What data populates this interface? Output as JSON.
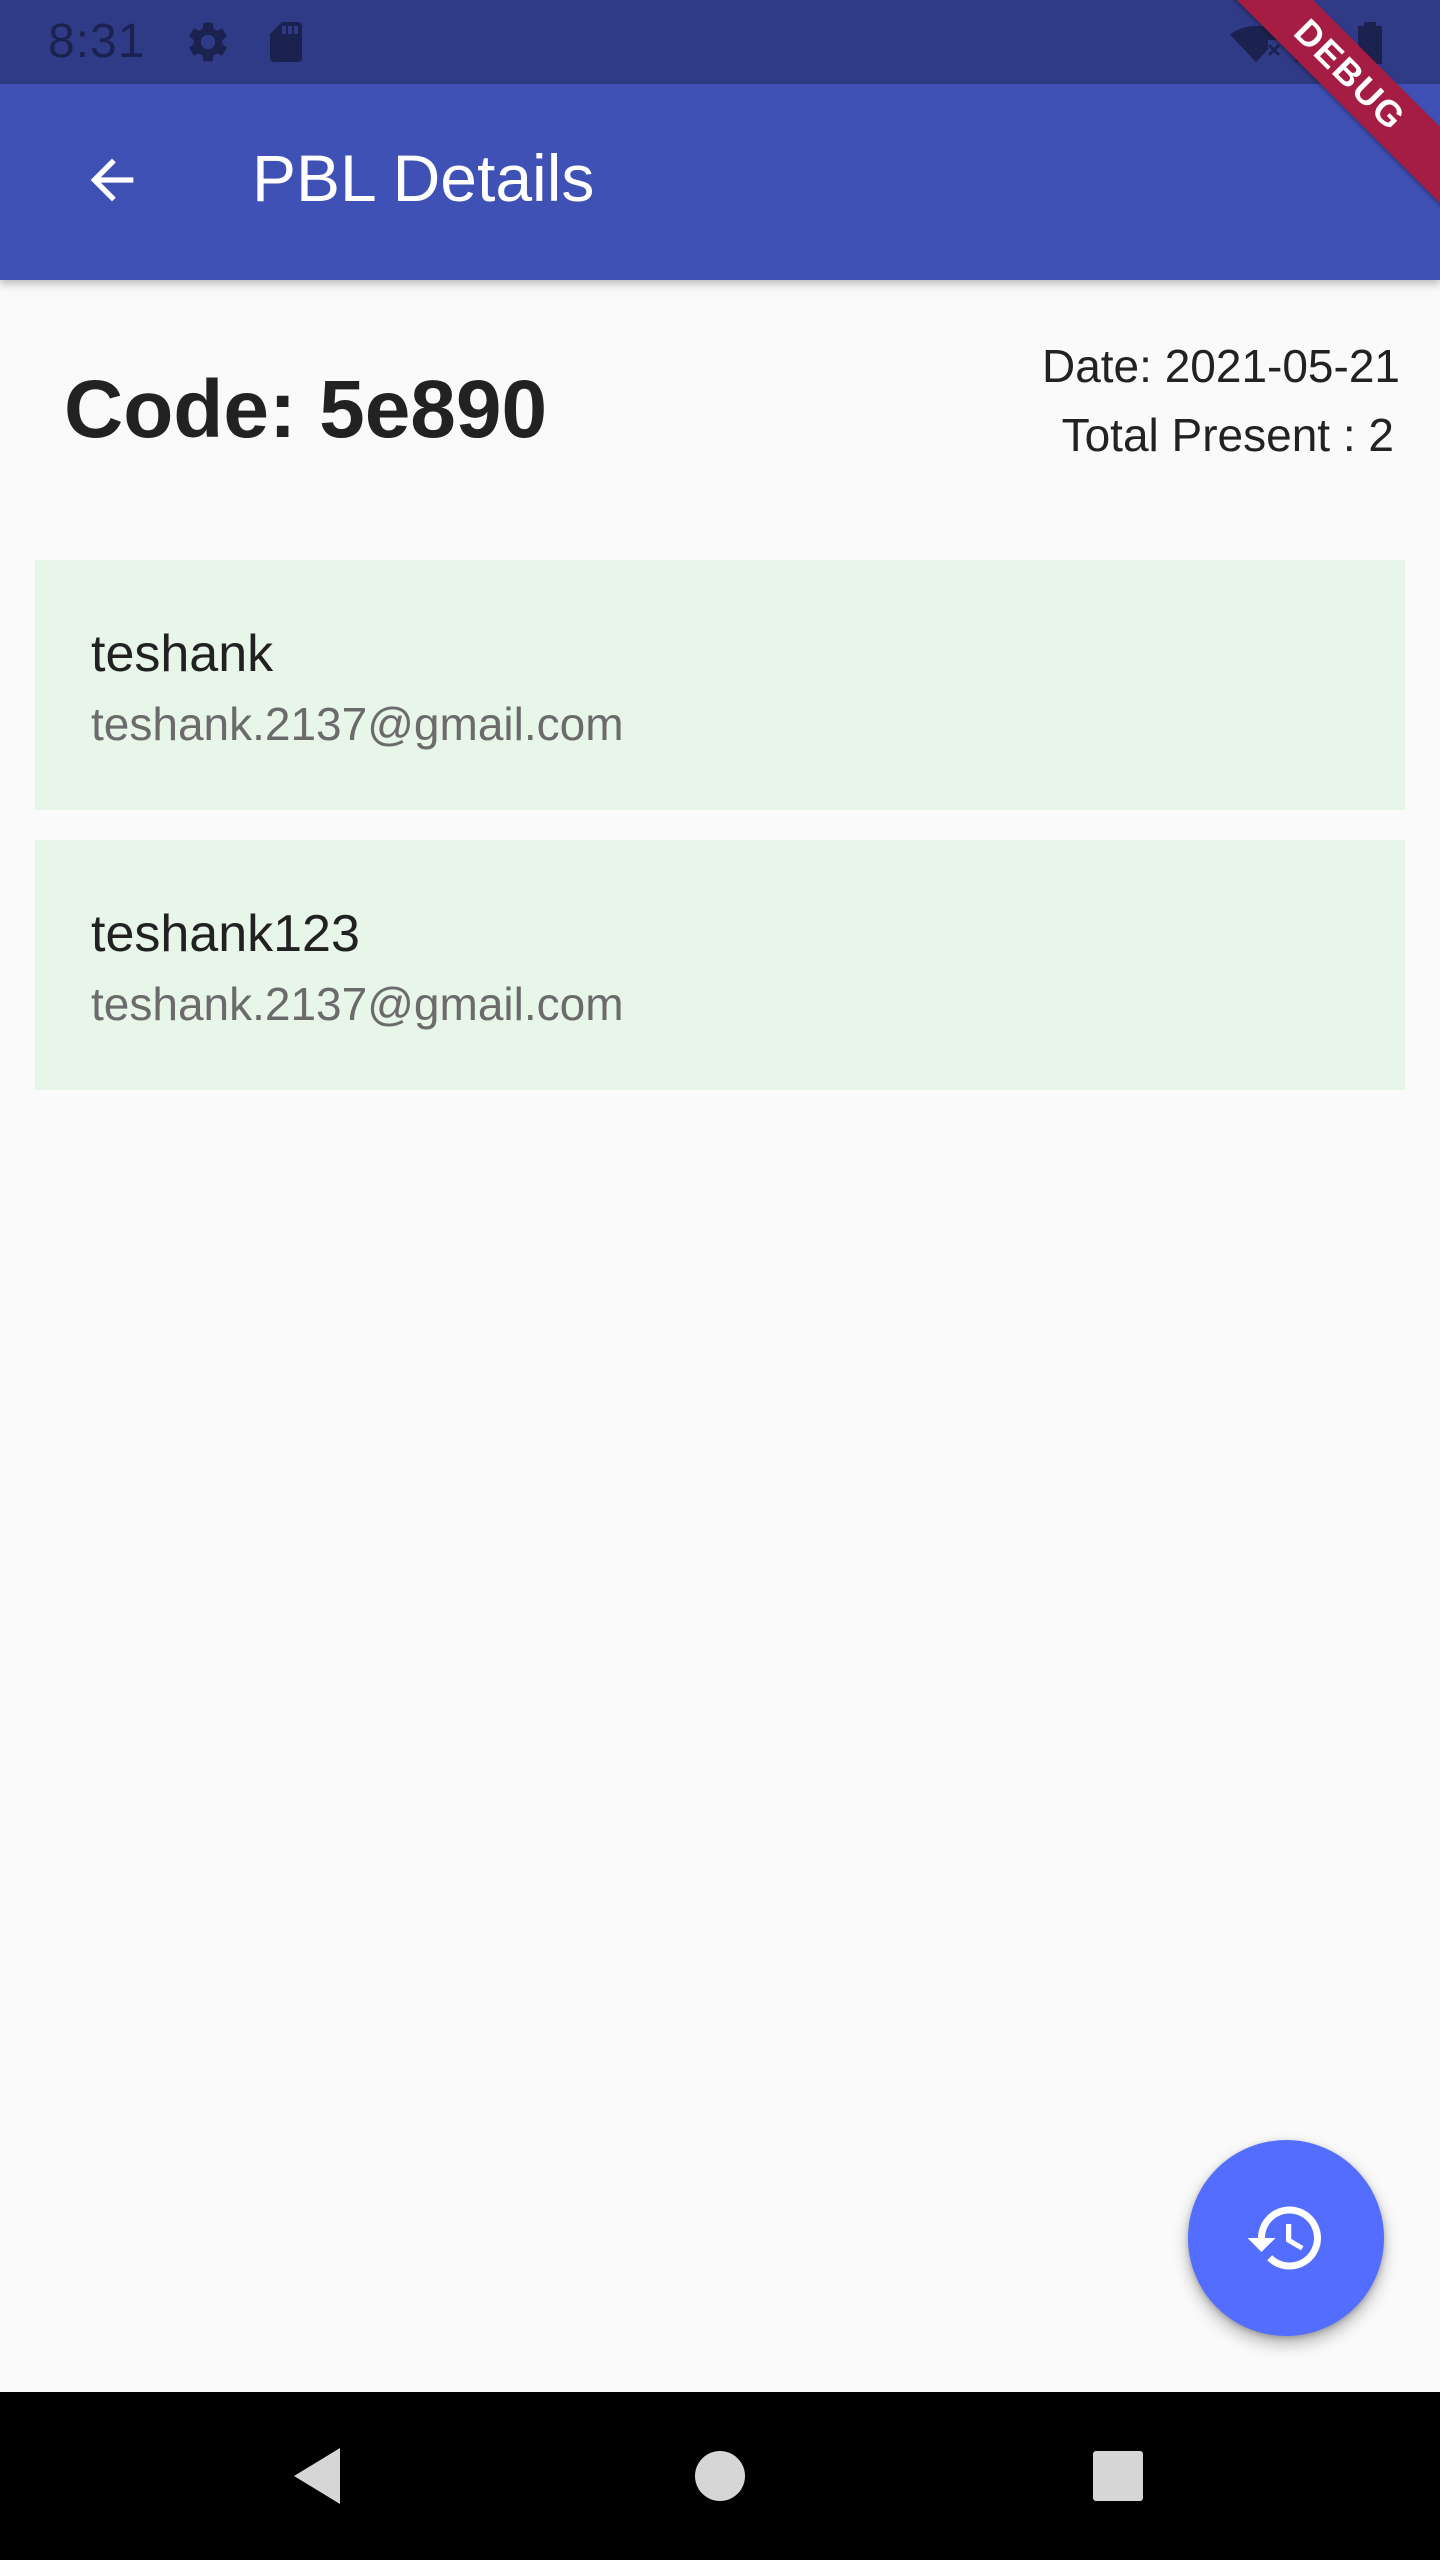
{
  "status_bar": {
    "time": "8:31",
    "left_icons": [
      "gear-icon",
      "sd-card-icon"
    ],
    "right_icons": [
      "wifi-off-icon",
      "signal-icon",
      "battery-icon"
    ],
    "background": "#2f3b86"
  },
  "debug_banner": {
    "label": "DEBUG",
    "color": "#a51d42"
  },
  "app_bar": {
    "title": "PBL Details",
    "back_icon": "arrow-back-icon",
    "background": "#3f51b5"
  },
  "header": {
    "code": "Code: 5e890",
    "date": "Date: 2021-05-21",
    "total_present": "Total Present : 2"
  },
  "attendees": [
    {
      "name": "teshank",
      "email": "teshank.2137@gmail.com"
    },
    {
      "name": "teshank123",
      "email": "teshank.2137@gmail.com"
    }
  ],
  "card_color": "#e8f5e9",
  "fab": {
    "icon": "history-icon",
    "color": "#536dfe"
  },
  "nav_bar": {
    "buttons": [
      "back-triangle-icon",
      "home-circle-icon",
      "recents-square-icon"
    ]
  }
}
